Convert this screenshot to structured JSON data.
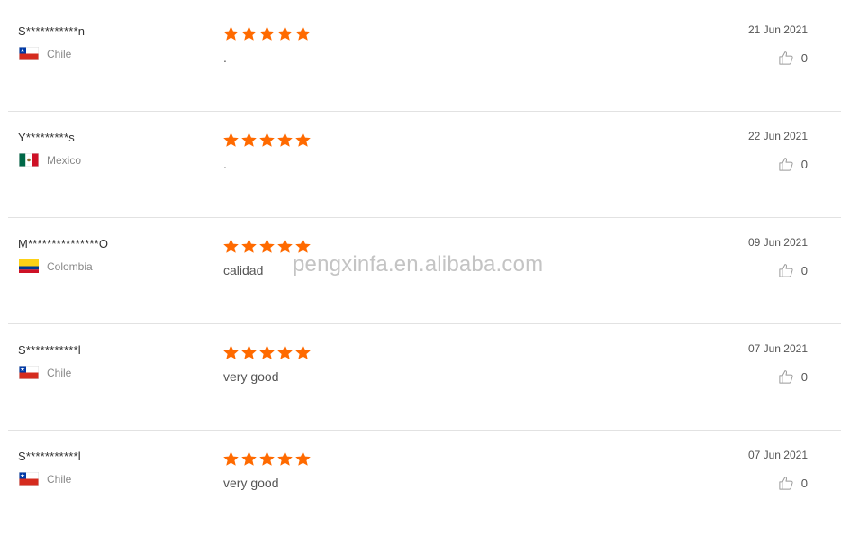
{
  "colors": {
    "star": "#ff6a00",
    "divider": "#e2e2e2"
  },
  "reviews": [
    {
      "name": "S***********n",
      "country": "Chile",
      "flag": "chile",
      "rating": 5,
      "comment": ".",
      "date": "21 Jun 2021",
      "likes": "0"
    },
    {
      "name": "Y*********s",
      "country": "Mexico",
      "flag": "mexico",
      "rating": 5,
      "comment": ".",
      "date": "22 Jun 2021",
      "likes": "0"
    },
    {
      "name": "M***************O",
      "country": "Colombia",
      "flag": "colombia",
      "rating": 5,
      "comment": "calidad",
      "date": "09 Jun 2021",
      "likes": "0"
    },
    {
      "name": "S***********l",
      "country": "Chile",
      "flag": "chile",
      "rating": 5,
      "comment": "very good",
      "date": "07 Jun 2021",
      "likes": "0"
    },
    {
      "name": "S***********l",
      "country": "Chile",
      "flag": "chile",
      "rating": 5,
      "comment": "very good",
      "date": "07 Jun 2021",
      "likes": "0"
    }
  ],
  "watermark": "pengxinfa.en.alibaba.com",
  "icons": {
    "star": "star-icon",
    "like": "thumbs-up-icon"
  }
}
